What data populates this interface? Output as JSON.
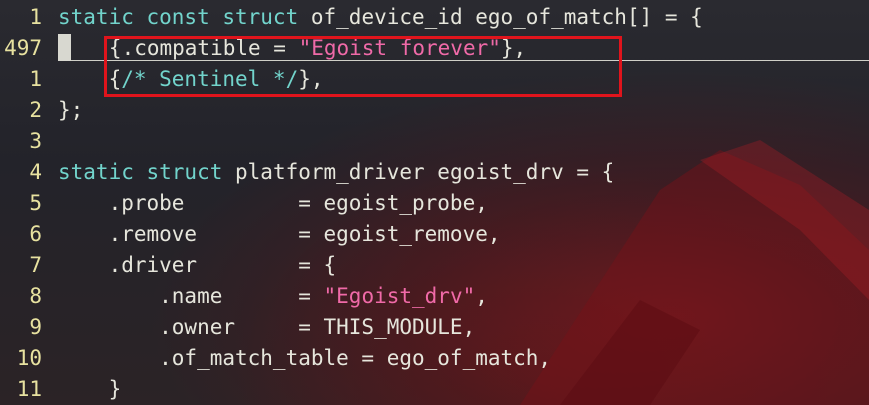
{
  "editor": {
    "lines": [
      {
        "num": "1",
        "parts": [
          [
            "kw",
            "static const struct "
          ],
          [
            "txt",
            "of_device_id ego_of_match[] = {"
          ]
        ]
      },
      {
        "num": "497",
        "cursor": true,
        "parts": [
          [
            "txt",
            "    {.compatible = "
          ],
          [
            "str",
            "\"Egoist forever\""
          ],
          [
            "txt",
            "},"
          ]
        ]
      },
      {
        "num": "1",
        "parts": [
          [
            "txt",
            "    {"
          ],
          [
            "cm",
            "/* Sentinel */"
          ],
          [
            "txt",
            "},"
          ]
        ]
      },
      {
        "num": "2",
        "parts": [
          [
            "txt",
            "};"
          ]
        ]
      },
      {
        "num": "3",
        "parts": [
          [
            "txt",
            ""
          ]
        ]
      },
      {
        "num": "4",
        "parts": [
          [
            "kw",
            "static struct "
          ],
          [
            "txt",
            "platform_driver egoist_drv = {"
          ]
        ]
      },
      {
        "num": "5",
        "parts": [
          [
            "txt",
            "    .probe         = egoist_probe,"
          ]
        ]
      },
      {
        "num": "6",
        "parts": [
          [
            "txt",
            "    .remove        = egoist_remove,"
          ]
        ]
      },
      {
        "num": "7",
        "parts": [
          [
            "txt",
            "    .driver        = {"
          ]
        ]
      },
      {
        "num": "8",
        "parts": [
          [
            "txt",
            "        .name      = "
          ],
          [
            "str",
            "\"Egoist_drv\""
          ],
          [
            "txt",
            ","
          ]
        ]
      },
      {
        "num": "9",
        "parts": [
          [
            "txt",
            "        .owner     = THIS_MODULE,"
          ]
        ]
      },
      {
        "num": "10",
        "parts": [
          [
            "txt",
            "        .of_match_table = ego_of_match,"
          ]
        ]
      },
      {
        "num": "11",
        "parts": [
          [
            "txt",
            "    }"
          ]
        ]
      }
    ],
    "colors": {
      "keyword": "#72d4cc",
      "string": "#f06aa8",
      "comment": "#72d4cc",
      "text": "#e6e6dc",
      "line_number": "#e8e2a0",
      "highlight_box": "#e0141c"
    }
  }
}
